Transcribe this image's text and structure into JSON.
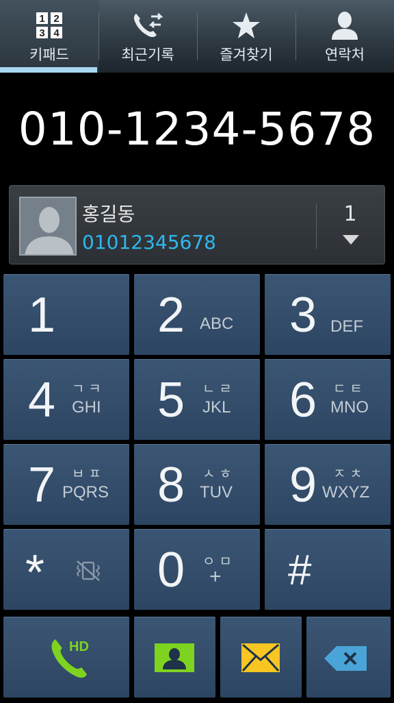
{
  "tabs": [
    {
      "label": "키패드",
      "icon": "keypad-icon",
      "active": true
    },
    {
      "label": "최근기록",
      "icon": "recent-calls-icon",
      "active": false
    },
    {
      "label": "즐겨찾기",
      "icon": "star-icon",
      "active": false
    },
    {
      "label": "연락처",
      "icon": "contact-person-icon",
      "active": false
    }
  ],
  "keypad_icon_digits": [
    "1",
    "2",
    "3",
    "4"
  ],
  "dialed_number": "010-1234-5678",
  "suggestion": {
    "name": "홍길동",
    "number": "01012345678",
    "match_count": "1"
  },
  "keys": [
    {
      "digit": "1",
      "letters": "",
      "hangul": ""
    },
    {
      "digit": "2",
      "letters": "ABC",
      "hangul": ""
    },
    {
      "digit": "3",
      "letters": "DEF",
      "hangul": ""
    },
    {
      "digit": "4",
      "letters": "GHI",
      "hangul": "ㄱㅋ"
    },
    {
      "digit": "5",
      "letters": "JKL",
      "hangul": "ㄴㄹ"
    },
    {
      "digit": "6",
      "letters": "MNO",
      "hangul": "ㄷㅌ"
    },
    {
      "digit": "7",
      "letters": "PQRS",
      "hangul": "ㅂㅍ"
    },
    {
      "digit": "8",
      "letters": "TUV",
      "hangul": "ㅅㅎ"
    },
    {
      "digit": "9",
      "letters": "WXYZ",
      "hangul": "ㅈㅊ"
    },
    {
      "digit": "*",
      "letters": "",
      "hangul": ""
    },
    {
      "digit": "0",
      "letters": "+",
      "hangul": "ㅇㅁ"
    },
    {
      "digit": "#",
      "letters": "",
      "hangul": ""
    }
  ],
  "bottom_bar": {
    "call_badge": "HD",
    "colors": {
      "call_green": "#7ed321",
      "contact_green": "#7ed321",
      "message_yellow": "#f7c623",
      "delete_blue": "#4aa4d8"
    }
  },
  "colors": {
    "accent_blue": "#2fb8ee",
    "tab_underline": "#a8d8f0",
    "key_bg": "#34506e"
  }
}
